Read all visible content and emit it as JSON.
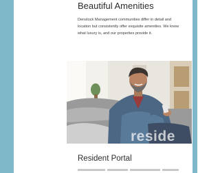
{
  "amenities": {
    "title": "Beautiful Amenities",
    "body": "Denstock Management communities differ in detail and location but consistently offer exquisite amenities. We know what luxury is, and our properties provide it."
  },
  "photo": {
    "alt": "Man relaxing on a sofa looking at his phone",
    "watermark": "reside"
  },
  "portal": {
    "title": "Resident Portal"
  },
  "colors": {
    "accent_bar": "#7fb9c9",
    "heading": "#2b2b2b",
    "body_text": "#3a3a3a"
  }
}
